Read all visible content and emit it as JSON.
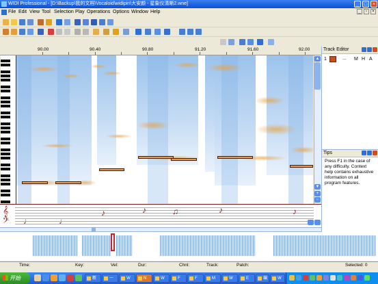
{
  "window": {
    "title": "WIDI Professional - [D:\\Backup\\我的文档\\Vocaloid\\widipin\\大安颜 - 星象仪清晰2.wne]",
    "controls": {
      "minimize": "_",
      "maximize": "□",
      "close": "×"
    }
  },
  "menu": {
    "items": [
      "File",
      "Edit",
      "View",
      "Tool",
      "Selection",
      "Play",
      "Operations",
      "Options",
      "Window",
      "Help"
    ],
    "mdi_controls": {
      "minimize": "_",
      "restore": "▫",
      "close": "×"
    }
  },
  "ruler": {
    "labels": [
      "90.00",
      "90.40",
      "90.80",
      "91.20",
      "91.60",
      "92.00"
    ]
  },
  "track_editor": {
    "title": "Track Editor",
    "track_number": "1",
    "track_color": "#c8501e",
    "ellipsis": "...",
    "m_label": "M",
    "h_label": "H",
    "a_label": "A"
  },
  "tips": {
    "title": "Tips",
    "text": "Press F1 in the case of any difficulty. Context help contains exhaustive information on all program features."
  },
  "statusbar": {
    "time": "Time:",
    "key": "Key:",
    "vel": "Vel:",
    "dur": "Dur:",
    "chnl": "Chnl:",
    "track": "Track:",
    "patch": "Patch:",
    "selected": "Selected: 0"
  },
  "taskbar": {
    "start": "开始",
    "tasks": [
      "新",
      "一",
      "W",
      "N",
      "W",
      "F",
      "F",
      "M",
      "W",
      "E",
      "编",
      "W"
    ]
  },
  "colors": {
    "accent": "#0a4fd6",
    "note_fill": "#e79c52",
    "score_note": "#a0151a",
    "selection": "#d02020"
  }
}
